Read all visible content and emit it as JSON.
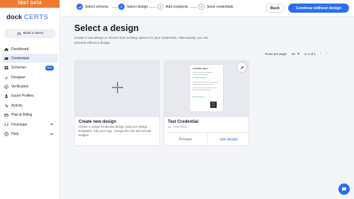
{
  "sidebar": {
    "test_banner": "TEST DATA",
    "logo_dock": "dock",
    "logo_certs": "CERTS",
    "book_demo": "Book a demo",
    "items": [
      {
        "label": "Dashboard",
        "icon": "home-icon"
      },
      {
        "label": "Credentials",
        "icon": "credentials-icon",
        "active": true
      },
      {
        "label": "Schemas",
        "icon": "schemas-icon",
        "badge": "New"
      },
      {
        "label": "Designer",
        "icon": "designer-icon"
      },
      {
        "label": "Verification",
        "icon": "verification-icon"
      },
      {
        "label": "Issuer Profiles",
        "icon": "issuer-profiles-icon"
      },
      {
        "label": "Activity",
        "icon": "activity-icon"
      },
      {
        "label": "Plan & Billing",
        "icon": "billing-icon"
      },
      {
        "label": "Developer",
        "icon": "developer-icon",
        "expandable": true
      },
      {
        "label": "Help",
        "icon": "help-icon",
        "expandable": true
      }
    ]
  },
  "stepper": {
    "steps": [
      {
        "label": "Select schema",
        "state": "done",
        "number": "1"
      },
      {
        "label": "Select design",
        "state": "current",
        "number": "2"
      },
      {
        "label": "Add recipients",
        "state": "todo",
        "number": "3"
      },
      {
        "label": "Send credentials",
        "state": "todo",
        "number": "4"
      }
    ]
  },
  "toolbar": {
    "back_label": "Back",
    "continue_label": "Continue without design"
  },
  "main": {
    "title": "Select a design",
    "description": "Create a new design or choose from existing options for your credentials. Alternatively, you can proceed without a design.",
    "pagination": {
      "rows_per_page_label": "Rows per page:",
      "rows_per_page_value": "10",
      "range": "1–1 of 1"
    },
    "cards": {
      "create": {
        "title": "Create new design",
        "text": "Create a unique credential design using our design templates. Add your logo, change the font and include images."
      },
      "credential": {
        "title": "Test Credential",
        "subtitle": "A4 - PORTRAIT",
        "preview_label": "Preview",
        "use_label": "Use design",
        "doc_title": "Credential subject",
        "doc_name": "{{ subject.name }}",
        "doc_signature": "Lorem ipsum"
      }
    }
  },
  "colors": {
    "accent": "#2b6ef2",
    "banner": "#f07b2e"
  }
}
